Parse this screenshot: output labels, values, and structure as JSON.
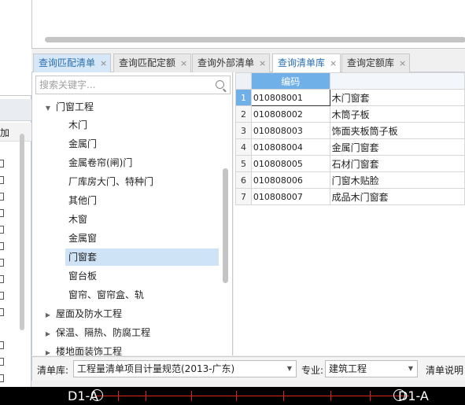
{
  "left_panel": {
    "column_label": "加"
  },
  "tabs": [
    {
      "label": "查询匹配清单",
      "close": "×"
    },
    {
      "label": "查询匹配定额",
      "close": "×"
    },
    {
      "label": "查询外部清单",
      "close": "×"
    },
    {
      "label": "查询清单库",
      "close": "×"
    },
    {
      "label": "查询定额库",
      "close": "×"
    }
  ],
  "search": {
    "placeholder": "搜索关键字..."
  },
  "tree": {
    "items": [
      {
        "label": "门窗工程",
        "arrow": "▼"
      },
      {
        "label": "木门"
      },
      {
        "label": "金属门"
      },
      {
        "label": "金属卷帘(闸)门"
      },
      {
        "label": "厂库房大门、特种门"
      },
      {
        "label": "其他门"
      },
      {
        "label": "木窗"
      },
      {
        "label": "金属窗"
      },
      {
        "label": "门窗套"
      },
      {
        "label": "窗台板"
      },
      {
        "label": "窗帘、窗帘盒、轨"
      },
      {
        "label": "屋面及防水工程",
        "arrow": "▶"
      },
      {
        "label": "保温、隔热、防腐工程",
        "arrow": "▶"
      },
      {
        "label": "楼地面装饰工程",
        "arrow": "▶"
      }
    ]
  },
  "grid": {
    "header": {
      "code": "编码",
      "name": ""
    },
    "rows": [
      {
        "num": "1",
        "code": "010808001",
        "name": "木门窗套"
      },
      {
        "num": "2",
        "code": "010808002",
        "name": "木筒子板"
      },
      {
        "num": "3",
        "code": "010808003",
        "name": "饰面夹板筒子板"
      },
      {
        "num": "4",
        "code": "010808004",
        "name": "金属门窗套"
      },
      {
        "num": "5",
        "code": "010808005",
        "name": "石材门窗套"
      },
      {
        "num": "6",
        "code": "010808006",
        "name": "门窗木贴脸"
      },
      {
        "num": "7",
        "code": "010808007",
        "name": "成品木门窗套"
      }
    ]
  },
  "bottom": {
    "library_label": "清单库:",
    "library_value": "工程量清单项目计量规范(2013-广东)",
    "major_label": "专业:",
    "major_value": "建筑工程",
    "desc_label": "清单说明",
    "caret": "▼"
  },
  "cad": {
    "left_axis": "D1-A",
    "right_axis": "D1-A"
  },
  "colors": {
    "accent": "#6fb0e8",
    "selected_tree": "#cfe3f7",
    "cad_line": "#d22"
  }
}
